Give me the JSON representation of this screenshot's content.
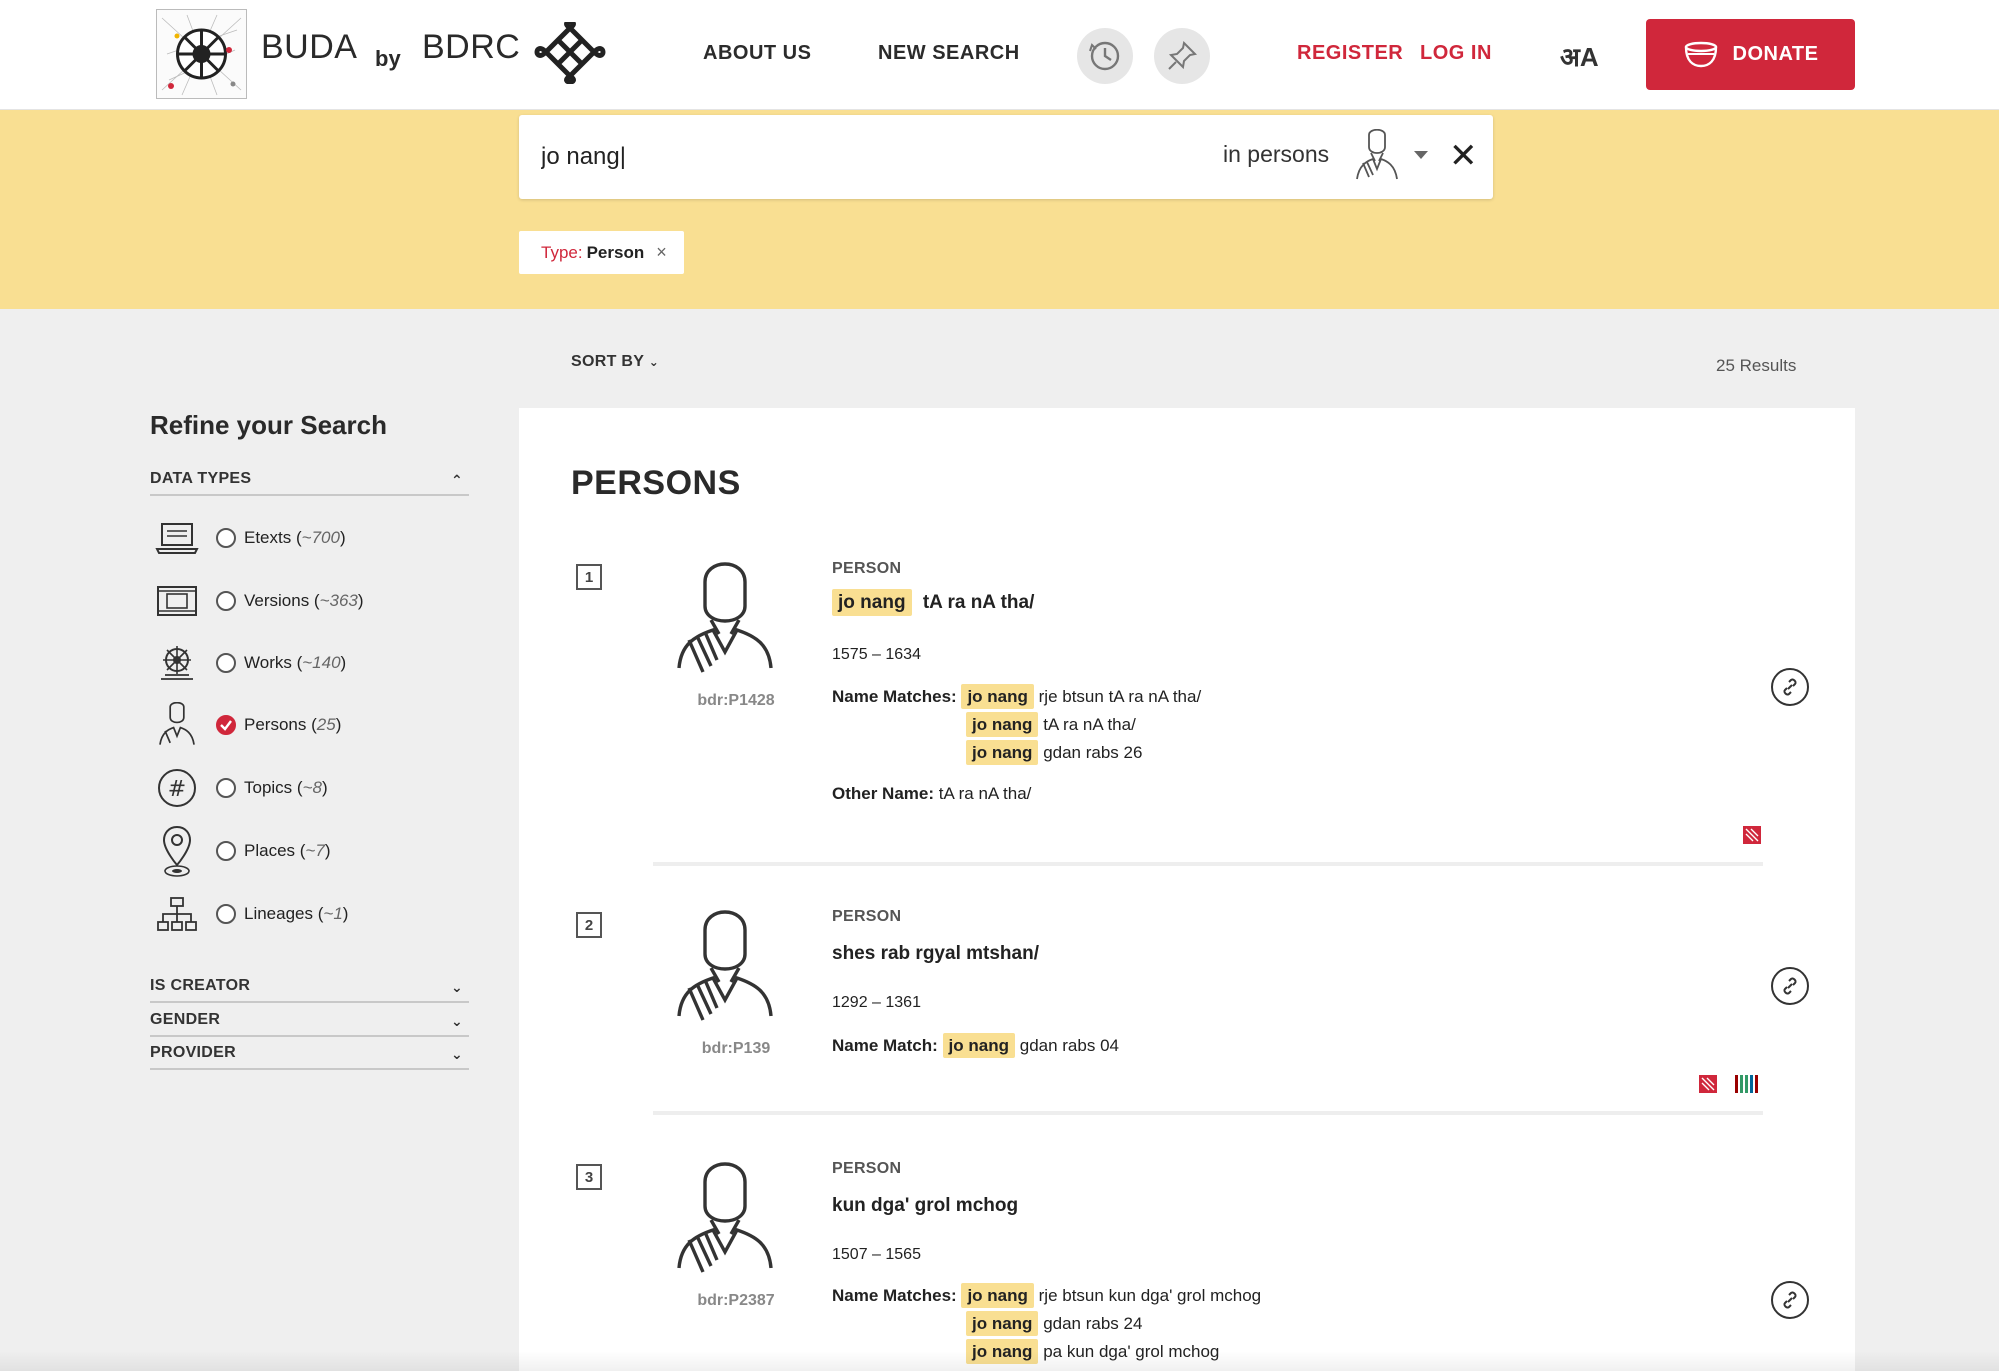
{
  "header": {
    "brand_name": "BUDA",
    "brand_by": "by",
    "brand_org": "BDRC",
    "nav": [
      "ABOUT US",
      "NEW SEARCH"
    ],
    "register": "REGISTER",
    "login": "LOG IN",
    "lang": "अA",
    "donate": "DONATE",
    "icons": [
      "history-icon",
      "pin-icon",
      "bowl-icon",
      "endless-knot-icon"
    ]
  },
  "search": {
    "query": "jo nang|",
    "scope_label": "in persons",
    "filter_key": "Type:",
    "filter_value": "Person",
    "filter_remove": "×"
  },
  "results_bar": {
    "sort_by": "SORT BY",
    "count": "25 Results"
  },
  "sidebar": {
    "title": "Refine your Search",
    "data_types_head": "DATA TYPES",
    "types": [
      {
        "label": "Etexts",
        "count": "~700",
        "checked": false,
        "icon": "laptop-icon"
      },
      {
        "label": "Versions",
        "count": "~363",
        "checked": false,
        "icon": "pecha-icon"
      },
      {
        "label": "Works",
        "count": "~140",
        "checked": false,
        "icon": "dharma-wheel-icon"
      },
      {
        "label": "Persons",
        "count": "25",
        "checked": true,
        "icon": "person-icon"
      },
      {
        "label": "Topics",
        "count": "~8",
        "checked": false,
        "icon": "hash-icon"
      },
      {
        "label": "Places",
        "count": "~7",
        "checked": false,
        "icon": "map-pin-icon"
      },
      {
        "label": "Lineages",
        "count": "~1",
        "checked": false,
        "icon": "hierarchy-icon"
      }
    ],
    "other_facets": [
      "IS CREATOR",
      "GENDER",
      "PROVIDER"
    ]
  },
  "panel": {
    "section_title": "PERSONS",
    "results": [
      {
        "index": "1",
        "id": "bdr:P1428",
        "type": "PERSON",
        "title_hl": "jo nang",
        "title_rest": "tA ra nA tha/",
        "dates": "1575 – 1634",
        "match_label": "Name Matches:",
        "matches": [
          {
            "hl": "jo nang",
            "rest": "rje btsun tA ra nA tha/"
          },
          {
            "hl": "jo nang",
            "rest": "tA ra nA tha/"
          },
          {
            "hl": "jo nang",
            "rest": "gdan rabs 26"
          }
        ],
        "other_label": "Other Name:",
        "other_value": "tA ra nA tha/"
      },
      {
        "index": "2",
        "id": "bdr:P139",
        "type": "PERSON",
        "title_hl": "",
        "title_rest": "shes rab rgyal mtshan/",
        "dates": "1292 – 1361",
        "match_label": "Name Match:",
        "matches": [
          {
            "hl": "jo nang",
            "rest": "gdan rabs 04"
          }
        ]
      },
      {
        "index": "3",
        "id": "bdr:P2387",
        "type": "PERSON",
        "title_hl": "",
        "title_rest": "kun dga' grol mchog",
        "dates": "1507 – 1565",
        "match_label": "Name Matches:",
        "matches": [
          {
            "hl": "jo nang",
            "rest": "rje btsun kun dga' grol mchog"
          },
          {
            "hl": "jo nang",
            "rest": "gdan rabs 24"
          },
          {
            "hl": "jo nang",
            "rest": "pa kun dga' grol mchog"
          }
        ]
      }
    ]
  },
  "colors": {
    "accent_red": "#d0273b",
    "highlight_yellow": "#f9df92",
    "band_yellow": "#f9df92",
    "page_bg": "#efefef"
  }
}
